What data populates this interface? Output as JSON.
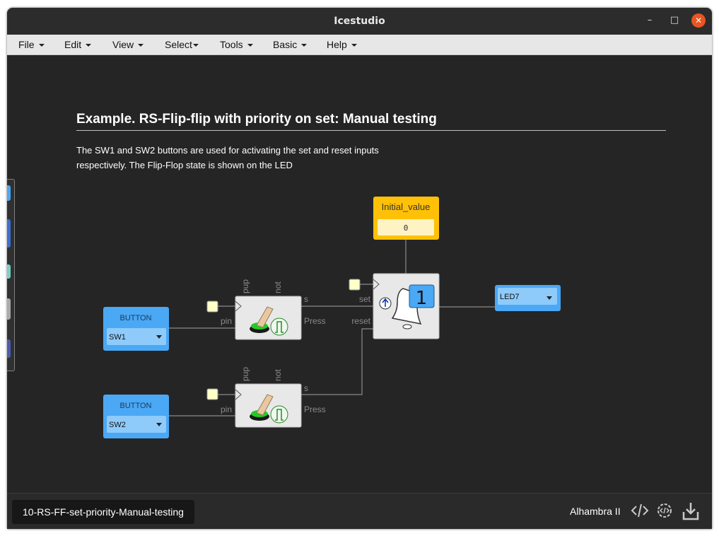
{
  "window": {
    "title": "Icestudio",
    "controls": {
      "minimize": "–",
      "maximize": "□",
      "close": "✕"
    }
  },
  "menu": {
    "items": [
      {
        "label": "File"
      },
      {
        "label": "Edit"
      },
      {
        "label": "View"
      },
      {
        "label": "Select"
      },
      {
        "label": "Tools"
      },
      {
        "label": "Basic"
      },
      {
        "label": "Help"
      }
    ]
  },
  "canvas": {
    "heading": "Example. RS-Flip-flip with priority on set: Manual testing",
    "description": "The SW1 and SW2 buttons are used for activating the set and reset inputs respectively. The Flip-Flop state is shown on the LED"
  },
  "blocks": {
    "button1": {
      "label": "BUTTON",
      "value": "SW1"
    },
    "button2": {
      "label": "BUTTON",
      "value": "SW2"
    },
    "switch1": {
      "port_pup": "pup",
      "port_not": "not",
      "port_pin": "pin",
      "port_s": "s",
      "port_press": "Press"
    },
    "switch2": {
      "port_pup": "pup",
      "port_not": "not",
      "port_pin": "pin",
      "port_s": "s",
      "port_press": "Press"
    },
    "initial": {
      "label": "Initial_value",
      "value": "0"
    },
    "ff": {
      "port_set": "set",
      "port_reset": "reset",
      "badge": "1"
    },
    "led": {
      "value": "LED7"
    }
  },
  "footer": {
    "file_tab": "10-RS-FF-set-priority-Manual-testing",
    "board": "Alhambra II",
    "icons": [
      "code-icon",
      "settings-code-icon",
      "download-icon"
    ]
  },
  "colors": {
    "background": "#252525",
    "io_block": "#4aa8f5",
    "constant_block": "#ffc107",
    "accent_close": "#e95420",
    "led_green": "#22cc22"
  }
}
